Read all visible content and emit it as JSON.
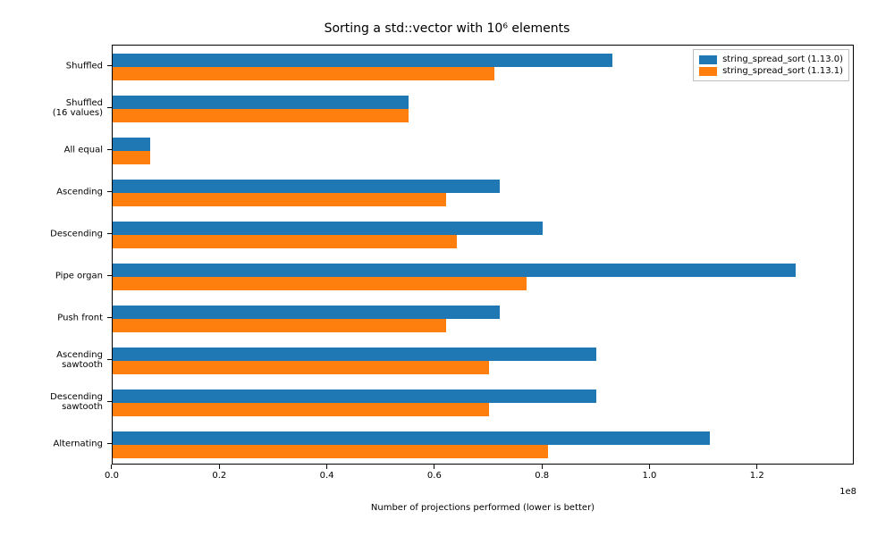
{
  "chart_data": {
    "type": "bar",
    "orientation": "horizontal",
    "title": "Sorting a std::vector with 10⁶ elements",
    "xlabel": "Number of projections performed (lower is better)",
    "ylabel": "",
    "x_exponent_label": "1e8",
    "xlim": [
      0,
      138000000.0
    ],
    "x_ticks": [
      0.0,
      0.2,
      0.4,
      0.6,
      0.8,
      1.0,
      1.2
    ],
    "x_tick_scale": 100000000.0,
    "x_tick_labels": [
      "0.0",
      "0.2",
      "0.4",
      "0.6",
      "0.8",
      "1.0",
      "1.2"
    ],
    "categories": [
      "Shuffled",
      "Shuffled\n(16 values)",
      "All equal",
      "Ascending",
      "Descending",
      "Pipe organ",
      "Push front",
      "Ascending\nsawtooth",
      "Descending\nsawtooth",
      "Alternating"
    ],
    "series": [
      {
        "name": "string_spread_sort (1.13.0)",
        "color": "#1f77b4",
        "values": [
          93000000.0,
          55000000.0,
          7000000.0,
          72000000.0,
          80000000.0,
          127000000.0,
          72000000.0,
          90000000.0,
          90000000.0,
          111000000.0
        ]
      },
      {
        "name": "string_spread_sort (1.13.1)",
        "color": "#ff7f0e",
        "values": [
          71000000.0,
          55000000.0,
          7000000.0,
          62000000.0,
          64000000.0,
          77000000.0,
          62000000.0,
          70000000.0,
          70000000.0,
          81000000.0
        ]
      }
    ],
    "legend_position": "upper right"
  }
}
